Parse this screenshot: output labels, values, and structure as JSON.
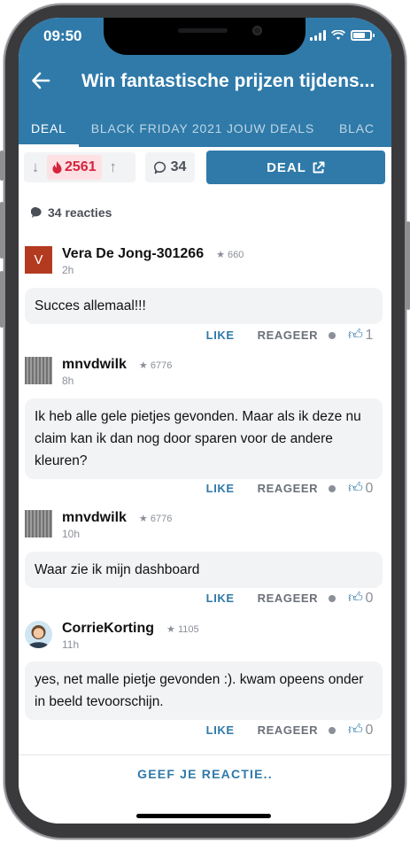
{
  "status": {
    "time": "09:50"
  },
  "header": {
    "title": "Win fantastische prijzen tijdens...",
    "tabs": [
      "DEAL",
      "BLACK FRIDAY 2021 JOUW DEALS",
      "BLAC"
    ],
    "active_tab": 0
  },
  "actions": {
    "temperature": "2561",
    "comment_count": "34",
    "deal_label": "DEAL"
  },
  "comments_header": "34 reacties",
  "comments": [
    {
      "user": "Vera De Jong-301266",
      "karma": "660",
      "time": "2h",
      "avatar": "V",
      "text": "Succes allemaal!!!",
      "like_label": "LIKE",
      "reply_label": "REAGEER",
      "likes": "1"
    },
    {
      "user": "mnvdwilk",
      "karma": "6776",
      "time": "8h",
      "avatar": "",
      "text": "Ik heb alle gele pietjes gevonden. Maar als ik deze nu claim kan ik dan nog door sparen voor de andere kleuren?",
      "like_label": "LIKE",
      "reply_label": "REAGEER",
      "likes": "0"
    },
    {
      "user": "mnvdwilk",
      "karma": "6776",
      "time": "10h",
      "avatar": "",
      "text": "Waar zie ik mijn dashboard",
      "like_label": "LIKE",
      "reply_label": "REAGEER",
      "likes": "0"
    },
    {
      "user": "CorrieKorting",
      "karma": "1105",
      "time": "11h",
      "avatar": "",
      "text": "yes, net malle pietje gevonden :). kwam opeens onder in beeld tevoorschijn.",
      "like_label": "LIKE",
      "reply_label": "REAGEER",
      "likes": "0"
    }
  ],
  "footer": {
    "cta": "GEEF JE REACTIE.."
  },
  "colors": {
    "brand": "#2f7aa9",
    "hot": "#d5243c",
    "bubble": "#f2f3f5"
  },
  "icons": {
    "back": "arrow-left-icon",
    "flame": "flame-icon",
    "comment": "speech-bubble-icon",
    "external": "external-link-icon",
    "star": "star-icon",
    "thumb": "thumbs-up-icon"
  }
}
